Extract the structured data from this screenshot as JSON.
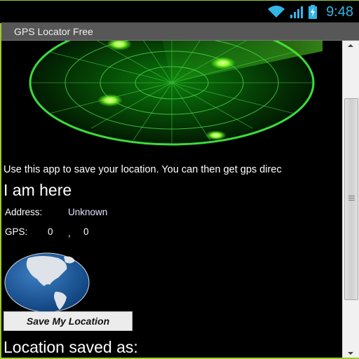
{
  "status_bar": {
    "time": "9:48",
    "icons": [
      "wifi-icon",
      "signal-icon",
      "battery-charging-icon"
    ],
    "accent_color": "#33b5e5"
  },
  "app": {
    "title": "GPS Locator Free"
  },
  "main": {
    "radar_image": "radar-graphic",
    "intro_text": "Use this app to save your location. You can then get gps direc",
    "heading": "I am here",
    "address_label": "Address:",
    "address_value": "Unknown",
    "gps_label": "GPS:",
    "gps_latitude": "0",
    "gps_separator": ",",
    "gps_longitude": "0",
    "globe_image": "globe-graphic",
    "save_button_label": "Save My Location",
    "saved_heading": "Location saved as:"
  },
  "scrollbar": {
    "position_fraction": 0.18
  }
}
